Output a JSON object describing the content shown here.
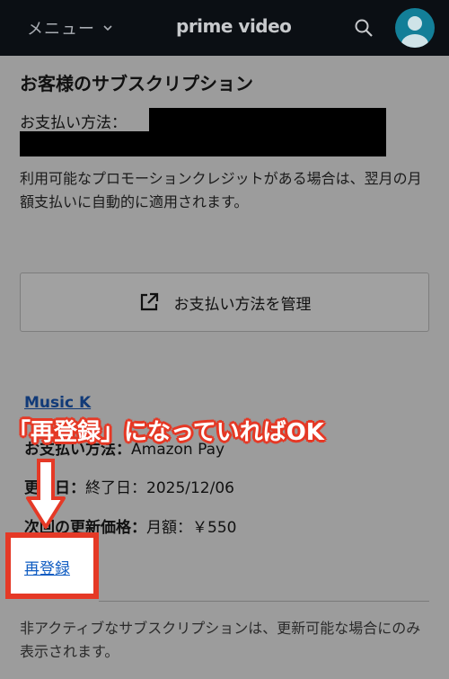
{
  "header": {
    "menu_label": "メニュー",
    "logo_text": "prime video",
    "icons": [
      "chevron-down-icon",
      "search-icon",
      "avatar"
    ]
  },
  "main": {
    "title": "お客様のサブスクリプション",
    "payment_label": "お支払い方法：",
    "promo_note": "利用可能なプロモーションクレジットがある場合は、翌月の月額支払いに自動的に適用されます。",
    "manage_button": "お支払い方法を管理",
    "subscription": {
      "name": "Music K",
      "payment_method_label": "お支払い方法",
      "payment_method_value": "Amazon Pay",
      "renewal_label": "更新日",
      "renewal_value": "終了日：2025/12/06",
      "next_price_label": "次回の更新価格",
      "next_price_value": "月額：￥550",
      "reregister_link": "再登録"
    },
    "footer_note": "非アクティブなサブスクリプションは、更新可能な場合にのみ表示されます。"
  },
  "annotation": {
    "callout_text": "「再登録」になっていればOK",
    "color": "#e53926"
  },
  "colors": {
    "header_bg": "#0b0f14",
    "page_bg": "#9c9c9c",
    "link": "#0f5cc2",
    "avatar": "#137f98"
  }
}
